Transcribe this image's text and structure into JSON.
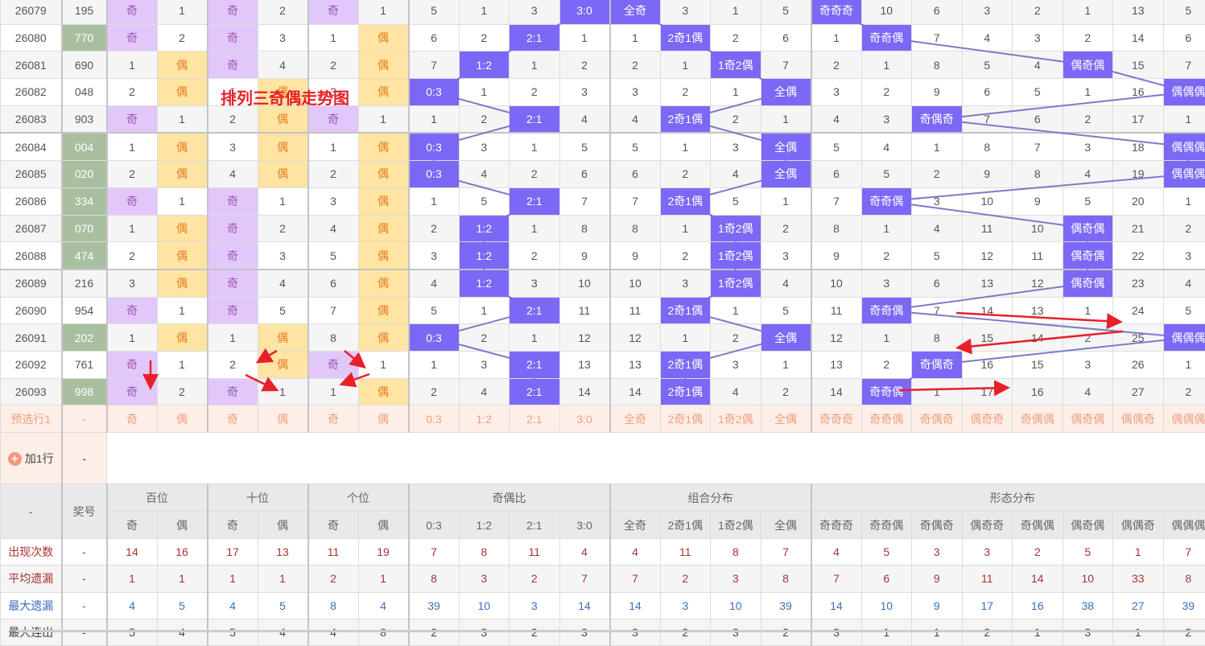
{
  "title": "排列三奇偶走势图",
  "colors": {
    "odd_bg": "#e2c8fa",
    "even_bg": "#ffe4a3",
    "hit_bg": "#7b68f5",
    "line": "#7b7bc8",
    "number_highlight": "#a8c0a0",
    "arrow": "#e8202a"
  },
  "rows": [
    {
      "period": "26079",
      "number": "195",
      "hl": false,
      "cells": [
        "奇",
        "1",
        "奇",
        "2",
        "奇",
        "1",
        "5",
        "1",
        "3",
        "3:0",
        "全奇",
        "3",
        "1",
        "5",
        "奇奇奇",
        "10",
        "6",
        "3",
        "2",
        "1",
        "13",
        "5"
      ]
    },
    {
      "period": "26080",
      "number": "770",
      "hl": true,
      "cells": [
        "奇",
        "2",
        "奇",
        "3",
        "1",
        "偶",
        "6",
        "2",
        "2:1",
        "1",
        "1",
        "2奇1偶",
        "2",
        "6",
        "1",
        "奇奇偶",
        "7",
        "4",
        "3",
        "2",
        "14",
        "6"
      ]
    },
    {
      "period": "26081",
      "number": "690",
      "hl": false,
      "cells": [
        "1",
        "偶",
        "奇",
        "4",
        "2",
        "偶",
        "7",
        "1:2",
        "1",
        "2",
        "2",
        "1",
        "1奇2偶",
        "7",
        "2",
        "1",
        "8",
        "5",
        "4",
        "偶奇偶",
        "15",
        "7"
      ]
    },
    {
      "period": "26082",
      "number": "048",
      "hl": false,
      "cells": [
        "2",
        "偶",
        "1",
        "偶",
        "3",
        "偶",
        "0:3",
        "1",
        "2",
        "3",
        "3",
        "2",
        "1",
        "全偶",
        "3",
        "2",
        "9",
        "6",
        "5",
        "1",
        "16",
        "偶偶偶"
      ]
    },
    {
      "period": "26083",
      "number": "903",
      "hl": false,
      "cells": [
        "奇",
        "1",
        "2",
        "偶",
        "奇",
        "1",
        "1",
        "2",
        "2:1",
        "4",
        "4",
        "2奇1偶",
        "2",
        "1",
        "4",
        "3",
        "奇偶奇",
        "7",
        "6",
        "2",
        "17",
        "1"
      ]
    },
    {
      "period": "26084",
      "number": "004",
      "hl": true,
      "cells": [
        "1",
        "偶",
        "3",
        "偶",
        "1",
        "偶",
        "0:3",
        "3",
        "1",
        "5",
        "5",
        "1",
        "3",
        "全偶",
        "5",
        "4",
        "1",
        "8",
        "7",
        "3",
        "18",
        "偶偶偶"
      ]
    },
    {
      "period": "26085",
      "number": "020",
      "hl": true,
      "cells": [
        "2",
        "偶",
        "4",
        "偶",
        "2",
        "偶",
        "0:3",
        "4",
        "2",
        "6",
        "6",
        "2",
        "4",
        "全偶",
        "6",
        "5",
        "2",
        "9",
        "8",
        "4",
        "19",
        "偶偶偶"
      ]
    },
    {
      "period": "26086",
      "number": "334",
      "hl": true,
      "cells": [
        "奇",
        "1",
        "奇",
        "1",
        "3",
        "偶",
        "1",
        "5",
        "2:1",
        "7",
        "7",
        "2奇1偶",
        "5",
        "1",
        "7",
        "奇奇偶",
        "3",
        "10",
        "9",
        "5",
        "20",
        "1"
      ]
    },
    {
      "period": "26087",
      "number": "070",
      "hl": true,
      "cells": [
        "1",
        "偶",
        "奇",
        "2",
        "4",
        "偶",
        "2",
        "1:2",
        "1",
        "8",
        "8",
        "1",
        "1奇2偶",
        "2",
        "8",
        "1",
        "4",
        "11",
        "10",
        "偶奇偶",
        "21",
        "2"
      ]
    },
    {
      "period": "26088",
      "number": "474",
      "hl": true,
      "cells": [
        "2",
        "偶",
        "奇",
        "3",
        "5",
        "偶",
        "3",
        "1:2",
        "2",
        "9",
        "9",
        "2",
        "1奇2偶",
        "3",
        "9",
        "2",
        "5",
        "12",
        "11",
        "偶奇偶",
        "22",
        "3"
      ]
    },
    {
      "period": "26089",
      "number": "216",
      "hl": false,
      "cells": [
        "3",
        "偶",
        "奇",
        "4",
        "6",
        "偶",
        "4",
        "1:2",
        "3",
        "10",
        "10",
        "3",
        "1奇2偶",
        "4",
        "10",
        "3",
        "6",
        "13",
        "12",
        "偶奇偶",
        "23",
        "4"
      ]
    },
    {
      "period": "26090",
      "number": "954",
      "hl": false,
      "cells": [
        "奇",
        "1",
        "奇",
        "5",
        "7",
        "偶",
        "5",
        "1",
        "2:1",
        "11",
        "11",
        "2奇1偶",
        "1",
        "5",
        "11",
        "奇奇偶",
        "7",
        "14",
        "13",
        "1",
        "24",
        "5"
      ]
    },
    {
      "period": "26091",
      "number": "202",
      "hl": true,
      "cells": [
        "1",
        "偶",
        "1",
        "偶",
        "8",
        "偶",
        "0:3",
        "2",
        "1",
        "12",
        "12",
        "1",
        "2",
        "全偶",
        "12",
        "1",
        "8",
        "15",
        "14",
        "2",
        "25",
        "偶偶偶"
      ]
    },
    {
      "period": "26092",
      "number": "761",
      "hl": false,
      "cells": [
        "奇",
        "1",
        "2",
        "偶",
        "奇",
        "1",
        "1",
        "3",
        "2:1",
        "13",
        "13",
        "2奇1偶",
        "3",
        "1",
        "13",
        "2",
        "奇偶奇",
        "16",
        "15",
        "3",
        "26",
        "1"
      ]
    },
    {
      "period": "26093",
      "number": "998",
      "hl": true,
      "cells": [
        "奇",
        "2",
        "奇",
        "1",
        "1",
        "偶",
        "2",
        "4",
        "2:1",
        "14",
        "14",
        "2奇1偶",
        "4",
        "2",
        "14",
        "奇奇偶",
        "1",
        "17",
        "16",
        "4",
        "27",
        "2"
      ]
    }
  ],
  "preselect": {
    "label": "预选行1",
    "number": "-",
    "cells": [
      "奇",
      "偶",
      "奇",
      "偶",
      "奇",
      "偶",
      "0:3",
      "1:2",
      "2:1",
      "3:0",
      "全奇",
      "2奇1偶",
      "1奇2偶",
      "全偶",
      "奇奇奇",
      "奇奇偶",
      "奇偶奇",
      "偶奇奇",
      "奇偶偶",
      "偶奇偶",
      "偶偶奇",
      "偶偶偶"
    ]
  },
  "add_row": {
    "label": "加1行",
    "number": "-"
  },
  "header": {
    "corner": "-",
    "number": "奖号",
    "groups": [
      {
        "label": "百位",
        "span": 2
      },
      {
        "label": "十位",
        "span": 2
      },
      {
        "label": "个位",
        "span": 2
      },
      {
        "label": "奇偶比",
        "span": 4
      },
      {
        "label": "组合分布",
        "span": 4
      },
      {
        "label": "形态分布",
        "span": 8
      }
    ],
    "subs": [
      "奇",
      "偶",
      "奇",
      "偶",
      "奇",
      "偶",
      "0:3",
      "1:2",
      "2:1",
      "3:0",
      "全奇",
      "2奇1偶",
      "1奇2偶",
      "全偶",
      "奇奇奇",
      "奇奇偶",
      "奇偶奇",
      "偶奇奇",
      "奇偶偶",
      "偶奇偶",
      "偶偶奇",
      "偶偶偶"
    ]
  },
  "stats": [
    {
      "label": "出现次数",
      "number": "-",
      "style": "red",
      "values": [
        "14",
        "16",
        "17",
        "13",
        "11",
        "19",
        "7",
        "8",
        "11",
        "4",
        "4",
        "11",
        "8",
        "7",
        "4",
        "5",
        "3",
        "3",
        "2",
        "5",
        "1",
        "7"
      ]
    },
    {
      "label": "平均遗漏",
      "number": "-",
      "style": "red",
      "values": [
        "1",
        "1",
        "1",
        "1",
        "2",
        "1",
        "8",
        "3",
        "2",
        "7",
        "7",
        "2",
        "3",
        "8",
        "7",
        "6",
        "9",
        "11",
        "14",
        "10",
        "33",
        "8"
      ]
    },
    {
      "label": "最大遗漏",
      "number": "-",
      "style": "blue",
      "values": [
        "4",
        "5",
        "4",
        "5",
        "8",
        "4",
        "39",
        "10",
        "3",
        "14",
        "14",
        "3",
        "10",
        "39",
        "14",
        "10",
        "9",
        "17",
        "16",
        "38",
        "27",
        "39"
      ]
    },
    {
      "label": "最大连出",
      "number": "-",
      "style": "dark",
      "values": [
        "5",
        "4",
        "5",
        "4",
        "4",
        "8",
        "2",
        "3",
        "2",
        "3",
        "3",
        "2",
        "3",
        "2",
        "3",
        "1",
        "1",
        "2",
        "1",
        "3",
        "1",
        "2"
      ]
    }
  ]
}
